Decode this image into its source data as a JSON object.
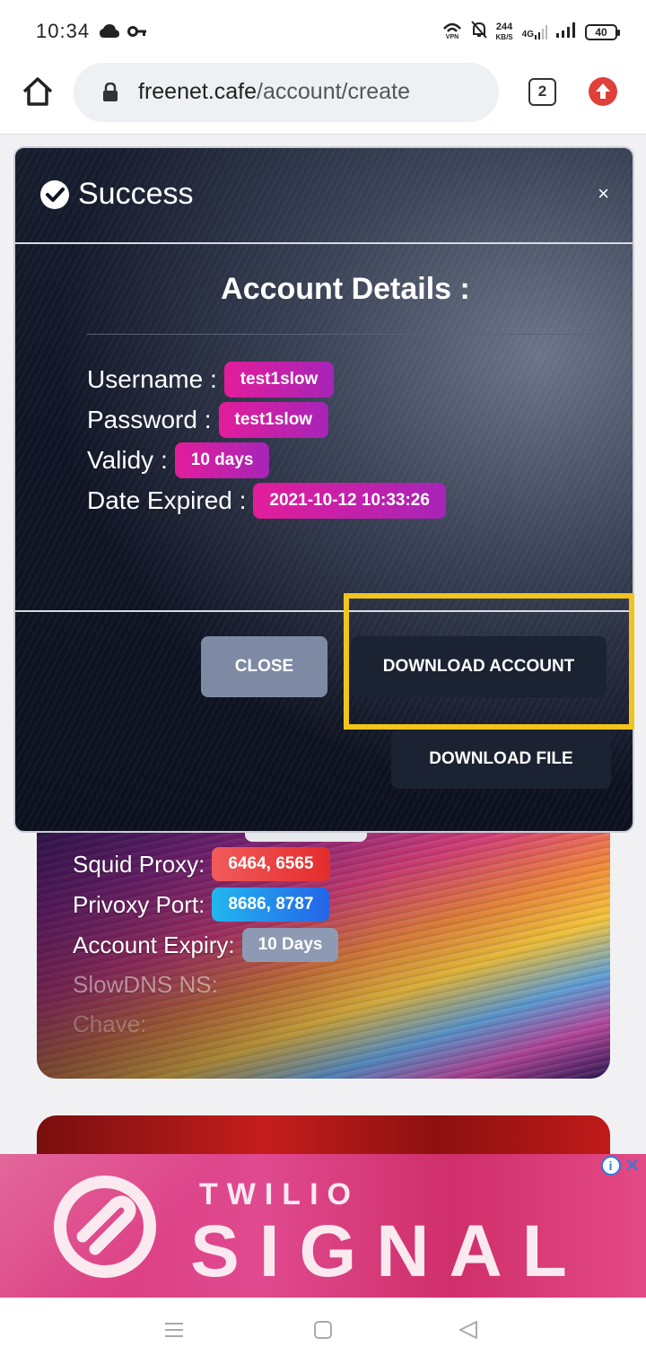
{
  "status_bar": {
    "time": "10:34",
    "net_speed_value": "244",
    "net_speed_unit": "KB/S",
    "network": "4G",
    "battery": "40"
  },
  "browser": {
    "url_host": "freenet.cafe",
    "url_path": "/account/create",
    "tab_count": "2"
  },
  "modal": {
    "title": "Success",
    "close_symbol": "×",
    "section_title": "Account Details :",
    "details": [
      {
        "label": "Username :",
        "value": "test1slow"
      },
      {
        "label": "Password :",
        "value": "test1slow"
      },
      {
        "label": "Validy :",
        "value": "10 days"
      },
      {
        "label": "Date Expired :",
        "value": "2021-10-12 10:33:26"
      }
    ],
    "buttons": {
      "close": "CLOSE",
      "download_account": "DOWNLOAD ACCOUNT",
      "download_file": "DOWNLOAD FILE"
    }
  },
  "page_card": {
    "rows": [
      {
        "label": "Squid Proxy:",
        "value": "6464, 6565"
      },
      {
        "label": "Privoxy Port:",
        "value": "8686, 8787"
      },
      {
        "label": "Account Expiry:",
        "value": "10 Days"
      },
      {
        "label": "SlowDNS NS:",
        "value": ""
      },
      {
        "label": "Chave:",
        "value": ""
      }
    ]
  },
  "ad": {
    "brand": "TWILIO",
    "product": "SIGNAL",
    "info_symbol": "i",
    "close_symbol": "✕"
  },
  "colors": {
    "highlight": "#f2c41e",
    "pill_gradient_start": "#e21d9b",
    "pill_gradient_end": "#a724b8",
    "update_badge": "#e0403a"
  },
  "icons": {
    "status_left": [
      "cloud-icon",
      "key-icon"
    ],
    "status_right": [
      "vpn-icon",
      "mute-icon",
      "signal-icon",
      "battery-icon"
    ],
    "browser": [
      "home-icon",
      "lock-icon",
      "tabs-icon",
      "update-arrow-icon"
    ],
    "nav": [
      "recent-apps-icon",
      "home-square-icon",
      "back-triangle-icon"
    ]
  }
}
